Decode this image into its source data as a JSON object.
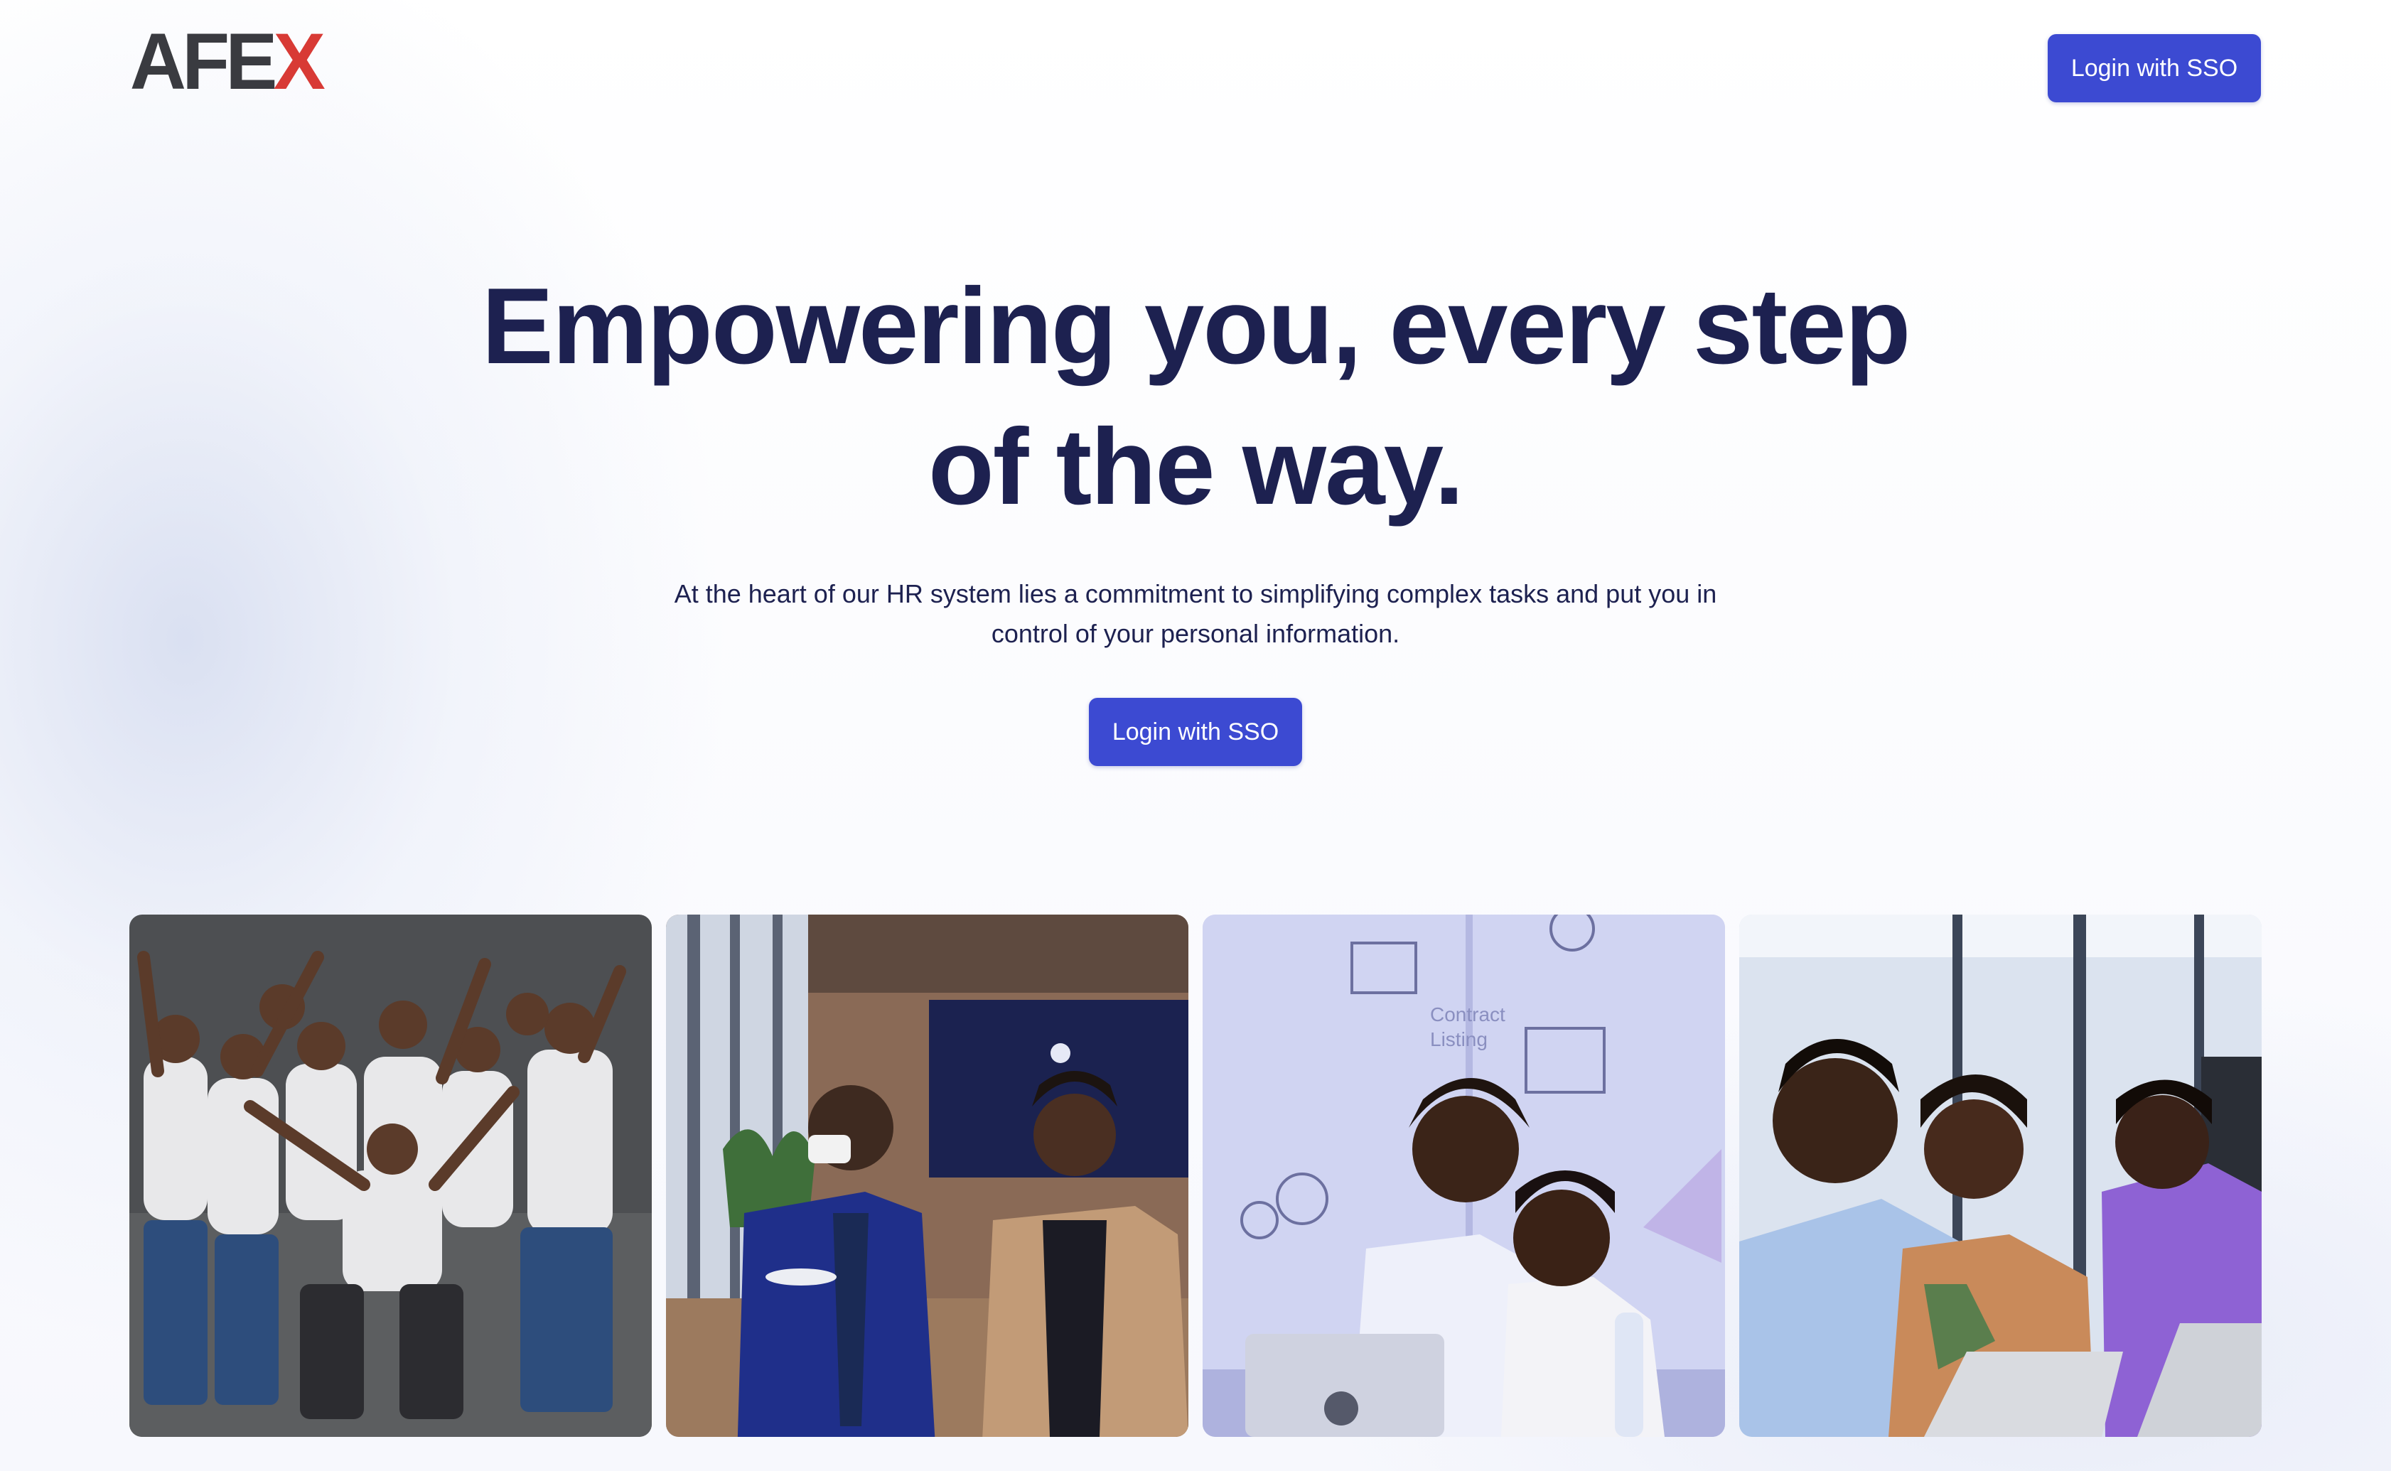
{
  "header": {
    "logo_text_main": "AFE",
    "logo_text_accent": "X",
    "login_label": "Login with SSO"
  },
  "hero": {
    "title": "Empowering you, every step of the way.",
    "subtitle": "At the heart of our HR system lies a commitment to simplifying complex tasks and put you in control of your personal information.",
    "login_label": "Login with SSO"
  },
  "colors": {
    "accent": "#3c4ad2",
    "heading": "#1d2150",
    "logo_dark": "#3a3b40",
    "logo_red": "#d83a35"
  },
  "gallery": {
    "photos": [
      {
        "name": "team-celebration-photo"
      },
      {
        "name": "office-colleagues-photo"
      },
      {
        "name": "laptop-collaboration-photo"
      },
      {
        "name": "team-at-laptop-photo"
      }
    ],
    "photo3_labels": [
      "Contract",
      "Listing"
    ]
  }
}
